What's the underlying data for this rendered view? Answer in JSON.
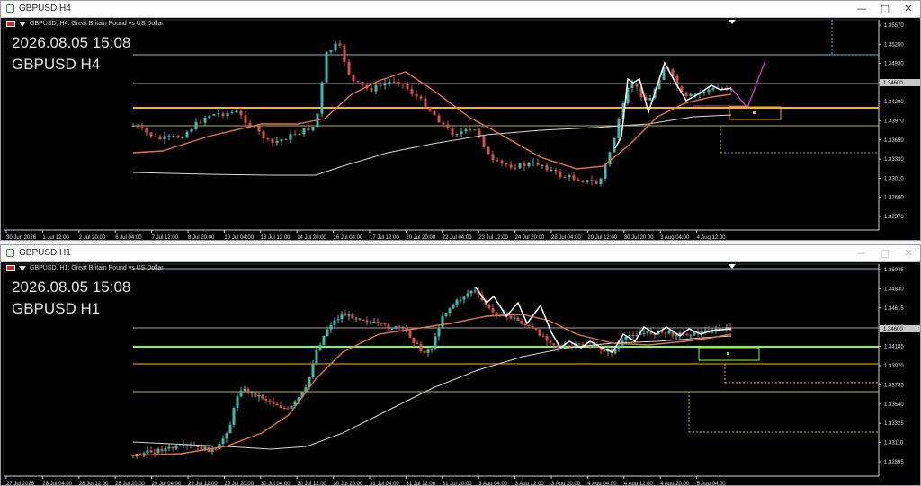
{
  "h4": {
    "title": "GBPUSD,H4",
    "symbol_desc": "GBPUSD, H4:  Great Britain Pound vs US Dollar",
    "date_text": "2026.08.05 15:08",
    "symbol_text": "GBPUSD H4",
    "price_ticks": [
      "1.35570",
      "1.35250",
      "1.34930",
      "1.34610",
      "1.34290",
      "1.33970",
      "1.33650",
      "1.33330",
      "1.33010",
      "1.32690",
      "1.32370"
    ],
    "current_price": "1.34600",
    "time_ticks": [
      "30 Jun 2026",
      "1 Jul 12:00",
      "2 Jul 20:00",
      "6 Jul 04:00",
      "7 Jul 12:00",
      "8 Jul 20:00",
      "10 Jul 04:00",
      "13 Jul 12:00",
      "14 Jul 20:00",
      "16 Jul 04:00",
      "17 Jul 12:00",
      "20 Jul 20:00",
      "22 Jul 04:00",
      "23 Jul 12:00",
      "24 Jul 20:00",
      "28 Jul 04:00",
      "29 Jul 12:00",
      "30 Jul 20:00",
      "3 Aug 04:00",
      "4 Aug 12:00"
    ]
  },
  "h1": {
    "title": "GBPUSD,H1",
    "symbol_desc": "GBPUSD, H1:  Great Britain Pound vs US Dollar",
    "date_text": "2026.08.05 15:08",
    "symbol_text": "GBPUSD H1",
    "price_ticks": [
      "1.35045",
      "1.34830",
      "1.34615",
      "1.34400",
      "1.34185",
      "1.33970",
      "1.33755",
      "1.33540",
      "1.33325",
      "1.33110",
      "1.32895"
    ],
    "current_price": "1.34600",
    "time_ticks": [
      "27 Jul 2026",
      "28 Jul 04:00",
      "28 Jul 12:00",
      "28 Jul 20:00",
      "29 Jul 04:00",
      "29 Jul 12:00",
      "29 Jul 20:00",
      "30 Jul 04:00",
      "30 Jul 12:00",
      "30 Jul 20:00",
      "31 Jul 04:00",
      "31 Jul 12:00",
      "31 Jul 20:00",
      "3 Aug 04:00",
      "3 Aug 12:00",
      "3 Aug 20:00",
      "4 Aug 04:00",
      "4 Aug 12:00",
      "4 Aug 20:00",
      "5 Aug 04:00"
    ]
  },
  "colors": {
    "bull": "#44b8b0",
    "bear": "#d4504c",
    "ma_fast": "#e8704a",
    "ma_slow": "#d8d8d8",
    "orange_level": "#ffb300",
    "green_level": "#7cfc3c",
    "olive_level": "#b8b840",
    "support_line": "#a4a4a4",
    "zigzag": "#ffffff",
    "projection": "#c040c0"
  },
  "icons": {
    "window_icon": "chart-window-icon",
    "minimize": "minimize-icon",
    "maximize": "maximize-icon",
    "close": "close-icon"
  }
}
